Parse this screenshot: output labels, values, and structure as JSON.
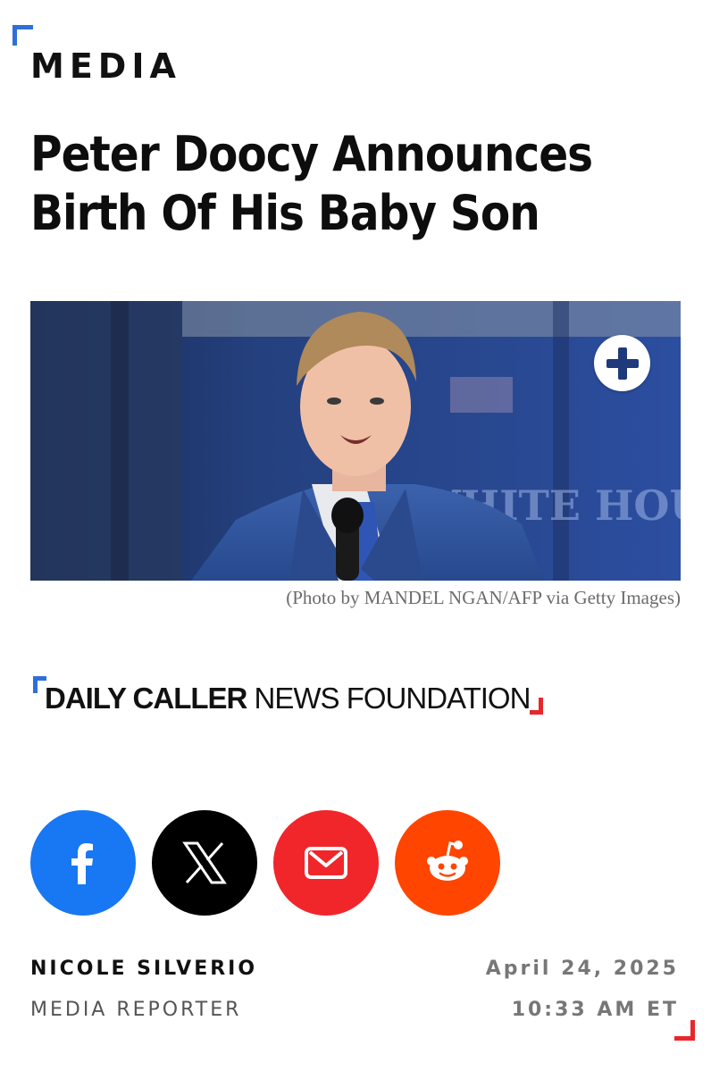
{
  "section": {
    "label": "MEDIA"
  },
  "article": {
    "headline": "Peter Doocy Announces Birth Of His Baby Son",
    "photo_caption": "(Photo by MANDEL NGAN/AFP via Getty Images)",
    "photo_background_text": "WHITE HOUSE"
  },
  "source": {
    "brand_bold": "DAILY CALLER",
    "brand_light": "NEWS FOUNDATION"
  },
  "share": [
    {
      "name": "facebook",
      "icon": "facebook-icon",
      "color": "#1877f2"
    },
    {
      "name": "x",
      "icon": "x-icon",
      "color": "#000000"
    },
    {
      "name": "email",
      "icon": "envelope-icon",
      "color": "#f0262b"
    },
    {
      "name": "reddit",
      "icon": "reddit-icon",
      "color": "#ff4500"
    }
  ],
  "byline": {
    "author": "NICOLE SILVERIO",
    "role": "MEDIA REPORTER",
    "date": "April 24, 2025",
    "time": "10:33 AM ET"
  },
  "colors": {
    "accent_blue": "#2f6fd8",
    "accent_red": "#e8272c"
  }
}
